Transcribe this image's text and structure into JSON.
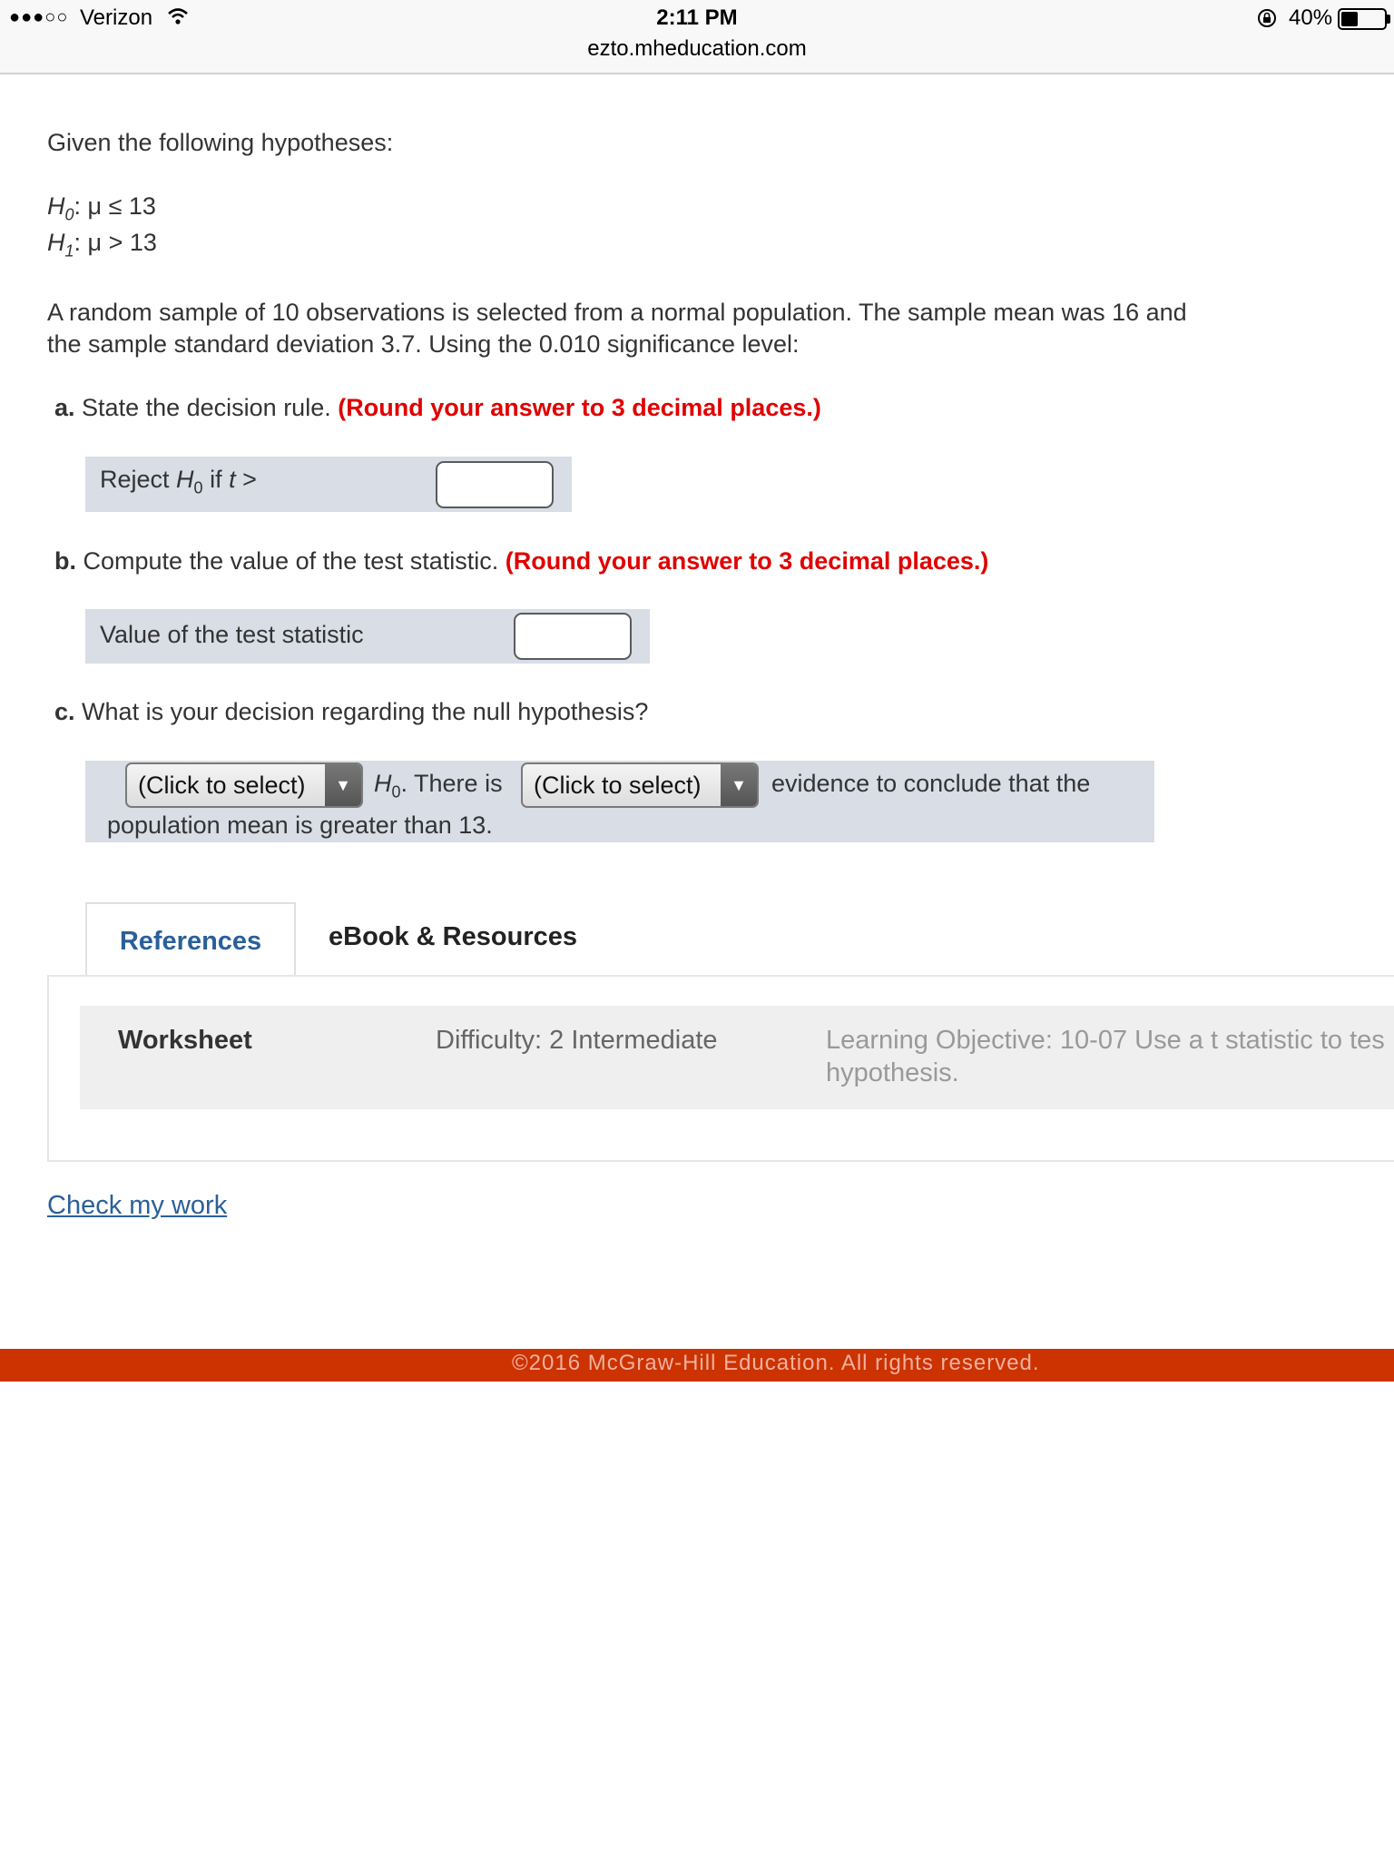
{
  "status_bar": {
    "signal": "●●●○○",
    "carrier": "Verizon",
    "wifi_icon": "wifi-icon",
    "time": "2:11 PM",
    "url": "ezto.mheducation.com",
    "lock_icon": "rotation-lock-icon",
    "battery_percent_label": "40%",
    "battery_level": 0.4
  },
  "question": {
    "intro": "Given the following hypotheses:",
    "h0": {
      "symbol": "H",
      "sub": "0",
      "rest": ": μ ≤ 13"
    },
    "h1": {
      "symbol": "H",
      "sub": "1",
      "rest": ": μ > 13"
    },
    "body_line1": "A random sample of 10 observations is selected from a normal population. The sample mean was 16 and",
    "body_line2": "the sample standard deviation 3.7. Using the 0.010 significance level:",
    "part_a": {
      "letter": "a.",
      "text": "State the decision rule.",
      "note": "(Round your answer to 3 decimal places.)",
      "row_pre": "Reject ",
      "row_h": "H",
      "row_sub": "0",
      "row_post": " if ",
      "row_t": "t",
      "row_gt": " >",
      "input_value": ""
    },
    "part_b": {
      "letter": "b.",
      "text": "Compute the value of the test statistic.",
      "note": "(Round your answer to 3 decimal places.)",
      "row_label": "Value of the test statistic",
      "input_value": ""
    },
    "part_c": {
      "letter": "c.",
      "text": "What is your decision regarding the null hypothesis?",
      "select1": "(Click to select)",
      "h": "H",
      "h_sub": "0",
      "mid_text": ". There is",
      "select2": "(Click to select)",
      "after_text": "evidence to conclude that the",
      "line2": "population mean is greater than 13.",
      "arrow": "▼"
    }
  },
  "tabs": {
    "references": "References",
    "ebook": "eBook & Resources"
  },
  "panel": {
    "worksheet": "Worksheet",
    "difficulty": "Difficulty: 2 Intermediate",
    "objective_line1": "Learning Objective: 10-07 Use a t statistic to tes",
    "objective_line2": "hypothesis."
  },
  "check_link": "Check my work",
  "footer": "©2016 McGraw-Hill Education. All rights reserved.",
  "colors": {
    "accent_red": "#e00000",
    "link_blue": "#2a6099",
    "footer_bar": "#cc3300",
    "answer_row_bg": "#d8dde6"
  }
}
